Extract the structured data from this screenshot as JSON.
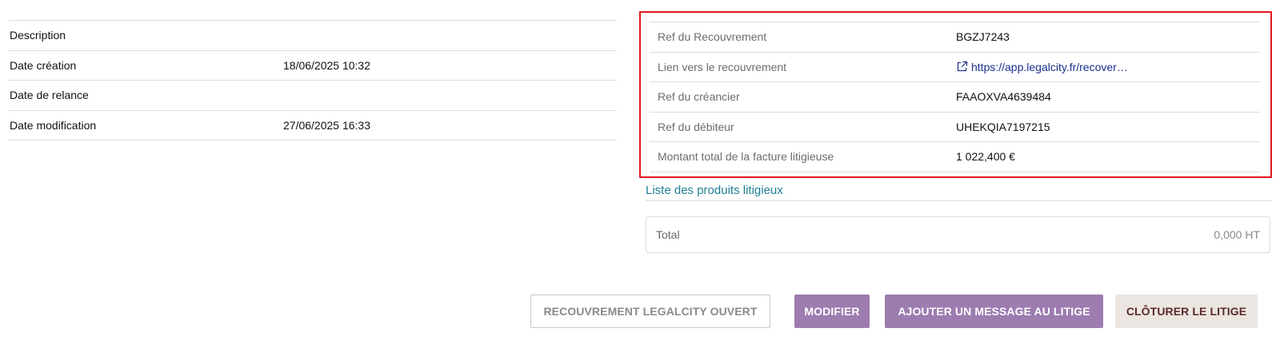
{
  "left_details": [
    {
      "label": "Description",
      "value": ""
    },
    {
      "label": "Date création",
      "value": "18/06/2025 10:32"
    },
    {
      "label": "Date de relance",
      "value": ""
    },
    {
      "label": "Date modification",
      "value": "27/06/2025 16:33"
    }
  ],
  "recovery": {
    "ref_recouvrement": {
      "label": "Ref du Recouvrement",
      "value": "BGZJ7243"
    },
    "lien": {
      "label": "Lien vers le recouvrement",
      "value": "https://app.legalcity.fr/recover…",
      "icon": "external-link-icon"
    },
    "ref_creancier": {
      "label": "Ref du créancier",
      "value": "FAAOXVA4639484"
    },
    "ref_debiteur": {
      "label": "Ref du débiteur",
      "value": "UHEKQIA7197215"
    },
    "montant": {
      "label": "Montant total de la facture litigieuse",
      "value": "1 022,400 €"
    }
  },
  "products": {
    "title": "Liste des produits litigieux",
    "total_label": "Total",
    "total_value": "0,000 HT"
  },
  "actions": {
    "recouvrement_open": "RECOUVREMENT LEGALCITY OUVERT",
    "modifier": "MODIFIER",
    "ajouter_message": "AJOUTER UN MESSAGE AU LITIGE",
    "cloturer": "CLÔTURER LE LITIGE"
  },
  "colors": {
    "highlight_border": "#e3161c",
    "primary_button": "#9d7cb0",
    "link": "#1a2f8c",
    "section_title": "#1f7f93"
  }
}
